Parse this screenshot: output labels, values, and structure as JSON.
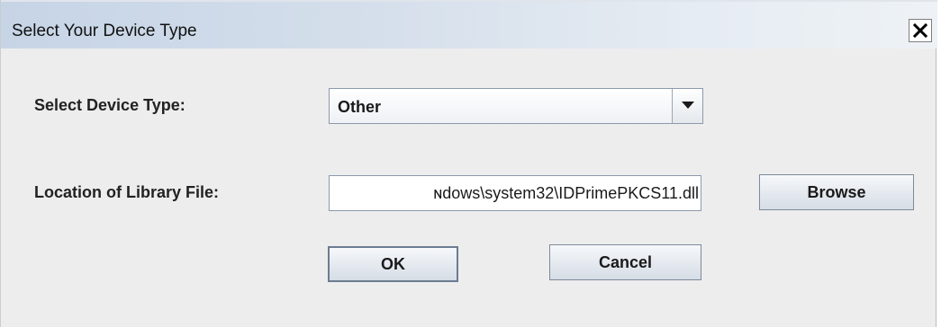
{
  "window": {
    "title": "Select Your Device Type",
    "close_icon": "close-icon"
  },
  "form": {
    "device_type_label": "Select Device Type:",
    "device_type_value": "Other",
    "library_label": "Location of Library File:",
    "library_value": "ɴdows\\system32\\IDPrimePKCS11.dll"
  },
  "buttons": {
    "browse": "Browse",
    "ok": "OK",
    "cancel": "Cancel"
  },
  "icons": {
    "dropdown": "chevron-down-icon"
  }
}
